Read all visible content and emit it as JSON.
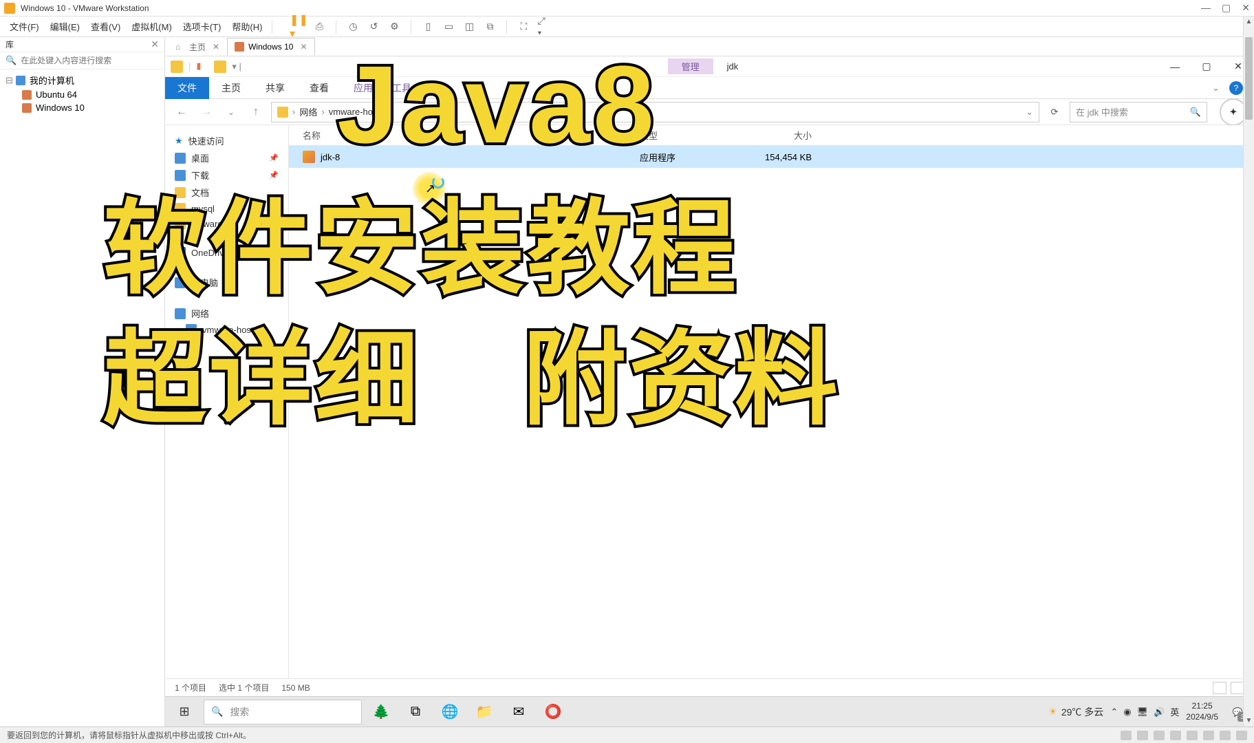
{
  "vmware": {
    "title": "Windows 10 - VMware Workstation",
    "menu": [
      "文件(F)",
      "编辑(E)",
      "查看(V)",
      "虚拟机(M)",
      "选项卡(T)",
      "帮助(H)"
    ],
    "library": {
      "header": "库",
      "search_placeholder": "在此处键入内容进行搜索",
      "root": "我的计算机",
      "vms": [
        "Ubuntu 64",
        "Windows 10"
      ]
    },
    "tabs": {
      "home": "主页",
      "active": "Windows 10"
    },
    "status": "要返回到您的计算机，请将鼠标指针从虚拟机中移出或按 Ctrl+Alt。"
  },
  "explorer": {
    "context_tab": "管理",
    "title": "jdk",
    "ribbon": {
      "file": "文件",
      "home": "主页",
      "share": "共享",
      "view": "查看",
      "apptools": "应用程序工具"
    },
    "addr": {
      "net": "网络",
      "host": "vmware-host"
    },
    "search_placeholder": "在 jdk 中搜索",
    "nav": {
      "quick": "快速访问",
      "desktop": "桌面",
      "downloads": "下载",
      "documents": "文档",
      "mysql": "mysql",
      "vmware": "vmware",
      "onedrive": "OneDrive",
      "thispc": "此电脑",
      "network": "网络",
      "vmhost": "vmware-host"
    },
    "columns": {
      "name": "名称",
      "type": "类型",
      "size": "大小"
    },
    "files": [
      {
        "name": "jdk-8",
        "type": "应用程序",
        "size": "154,454 KB"
      }
    ],
    "status": {
      "count": "1 个项目",
      "selected": "选中 1 个项目",
      "size": "150 MB"
    }
  },
  "taskbar": {
    "search_placeholder": "搜索",
    "weather": "29℃ 多云",
    "ime": "英",
    "time": "21:25",
    "date": "2024/9/5",
    "notif": "3"
  },
  "overlay": {
    "line1": "Java8",
    "line2": "软件安装教程",
    "line3a": "超详细",
    "line3b": "附资料"
  }
}
